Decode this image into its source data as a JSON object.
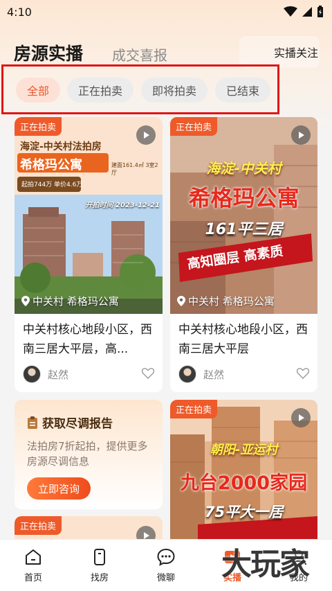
{
  "status": {
    "time": "4:10"
  },
  "header": {
    "title": "房源实播",
    "secondary_tab": "成交喜报",
    "follow_label": "实播关注"
  },
  "filters": [
    "全部",
    "正在拍卖",
    "即将拍卖",
    "已结束"
  ],
  "cards": [
    {
      "badge": "正在拍卖",
      "image_headline": "海淀-中关村法拍房",
      "image_name": "希格玛公寓",
      "image_meta": "建面161.4㎡ 3室2厅",
      "image_price": "起拍744万  单价4.6万",
      "image_date": "开拍时间 2023-12-21",
      "location": "中关村 希格玛公寓",
      "title": "中关村核心地段小区，西南三居大平层，高...",
      "author": "赵然"
    },
    {
      "badge": "正在拍卖",
      "image_headline": "海淀-中关村",
      "image_name": "希格玛公寓",
      "image_meta": "161平三居",
      "image_tag": "高知圈层 高素质",
      "location": "中关村 希格玛公寓",
      "title": "中关村核心地段小区，西南三居大平层",
      "author": "赵然"
    },
    {
      "badge": "正在拍卖",
      "image_headline": "朝阳-亚运村",
      "image_name": "九台2000家园",
      "image_meta": "75平大一居"
    },
    {
      "badge": "正在拍卖"
    }
  ],
  "promo": {
    "title": "获取尽调报告",
    "desc": "法拍房7折起拍，提供更多房源尽调信息",
    "button": "立即咨询"
  },
  "nav": [
    {
      "label": "首页",
      "icon": "home-icon"
    },
    {
      "label": "找房",
      "icon": "phone-icon"
    },
    {
      "label": "微聊",
      "icon": "chat-icon"
    },
    {
      "label": "实播",
      "icon": "live-icon"
    },
    {
      "label": "我的",
      "icon": "profile-icon"
    }
  ],
  "watermark": "大玩家",
  "colors": {
    "accent": "#ee5a2a",
    "highlight_box": "#e01515"
  }
}
